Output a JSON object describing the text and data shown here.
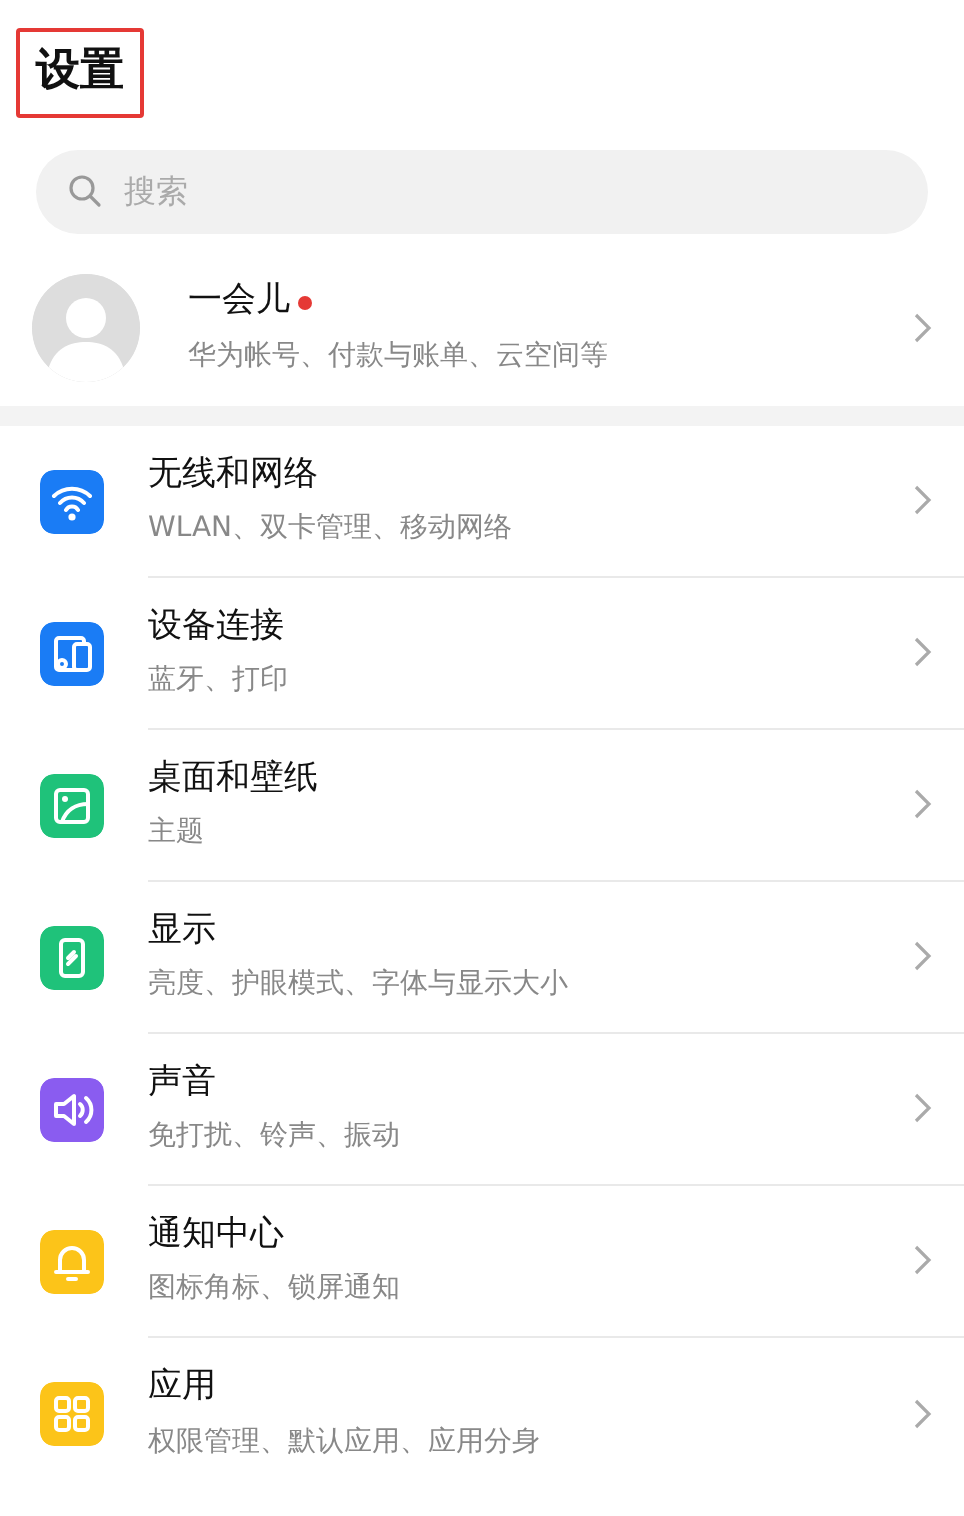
{
  "title": {
    "text": "设置",
    "highlighted": true
  },
  "search": {
    "placeholder": "搜索"
  },
  "account": {
    "name": "一会儿",
    "unread": true,
    "subtitle": "华为帐号、付款与账单、云空间等"
  },
  "items": [
    {
      "kind": "wifi",
      "color": "#1a7cf5",
      "title": "无线和网络",
      "subtitle": "WLAN、双卡管理、移动网络"
    },
    {
      "kind": "devices",
      "color": "#1a7cf5",
      "title": "设备连接",
      "subtitle": "蓝牙、打印"
    },
    {
      "kind": "image",
      "color": "#1fc27a",
      "title": "桌面和壁纸",
      "subtitle": "主题"
    },
    {
      "kind": "phone",
      "color": "#1fc27a",
      "title": "显示",
      "subtitle": "亮度、护眼模式、字体与显示大小"
    },
    {
      "kind": "speaker",
      "color": "#8a5cf0",
      "title": "声音",
      "subtitle": "免打扰、铃声、振动"
    },
    {
      "kind": "bell",
      "color": "#fcc419",
      "title": "通知中心",
      "subtitle": "图标角标、锁屏通知"
    },
    {
      "kind": "grid",
      "color": "#fcc419",
      "title": "应用",
      "subtitle": "权限管理、默认应用、应用分身"
    }
  ]
}
